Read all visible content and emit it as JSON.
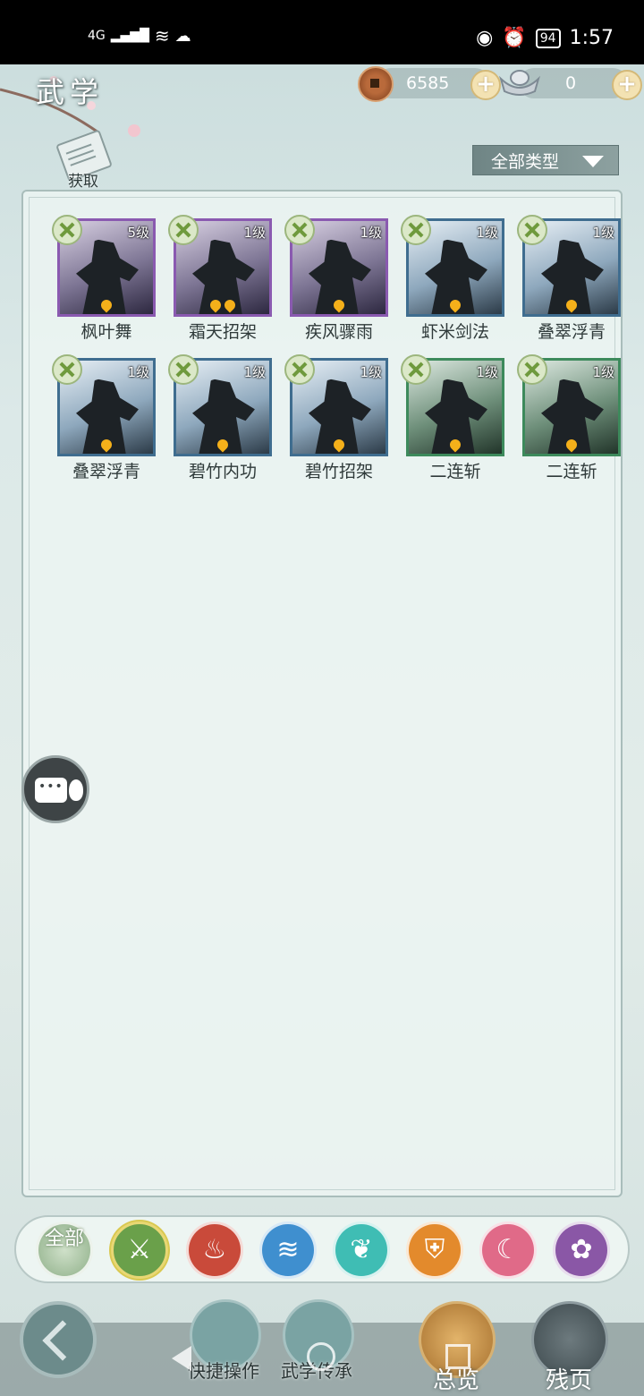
{
  "status_bar": {
    "network": "4G",
    "battery": "94",
    "time": "1:57"
  },
  "header": {
    "title": "武学"
  },
  "currency": {
    "copper": {
      "icon": "copper-coin-icon",
      "value": "6585"
    },
    "silver": {
      "icon": "silver-ingot-icon",
      "value": "0"
    }
  },
  "acquire": {
    "label": "获取",
    "icon": "scroll-icon"
  },
  "filter": {
    "selected": "全部类型"
  },
  "skills": [
    {
      "name": "枫叶舞",
      "level": "5级",
      "rarity": "purple",
      "flames": 1
    },
    {
      "name": "霜天招架",
      "level": "1级",
      "rarity": "purple",
      "flames": 2
    },
    {
      "name": "疾风骤雨",
      "level": "1级",
      "rarity": "purple",
      "flames": 1
    },
    {
      "name": "虾米剑法",
      "level": "1级",
      "rarity": "blue",
      "flames": 1
    },
    {
      "name": "叠翠浮青",
      "level": "1级",
      "rarity": "blue",
      "flames": 1
    },
    {
      "name": "叠翠浮青",
      "level": "1级",
      "rarity": "blue",
      "flames": 1
    },
    {
      "name": "碧竹内功",
      "level": "1级",
      "rarity": "blue",
      "flames": 1
    },
    {
      "name": "碧竹招架",
      "level": "1级",
      "rarity": "blue",
      "flames": 1
    },
    {
      "name": "二连斩",
      "level": "1级",
      "rarity": "green",
      "flames": 1
    },
    {
      "name": "二连斩",
      "level": "1级",
      "rarity": "green",
      "flames": 1
    }
  ],
  "sects": [
    {
      "id": "all",
      "label": "全部",
      "color": "#9dbb95"
    },
    {
      "id": "bamboo",
      "glyph": "⚔",
      "color": "#6aa04a",
      "selected": true
    },
    {
      "id": "flame",
      "glyph": "♨",
      "color": "#c94a3a"
    },
    {
      "id": "wave",
      "glyph": "≋",
      "color": "#3f8fcf"
    },
    {
      "id": "butterfly",
      "glyph": "❦",
      "color": "#3fbdb4"
    },
    {
      "id": "shield",
      "glyph": "⛨",
      "color": "#e38a2c"
    },
    {
      "id": "moon",
      "glyph": "☾",
      "color": "#e06a88"
    },
    {
      "id": "rose",
      "glyph": "✿",
      "color": "#8a57a6"
    }
  ],
  "bottom_nav": {
    "quick_ops": "快捷操作",
    "inheritance": "武学传承",
    "overview": "总览",
    "fragments": "残页"
  }
}
